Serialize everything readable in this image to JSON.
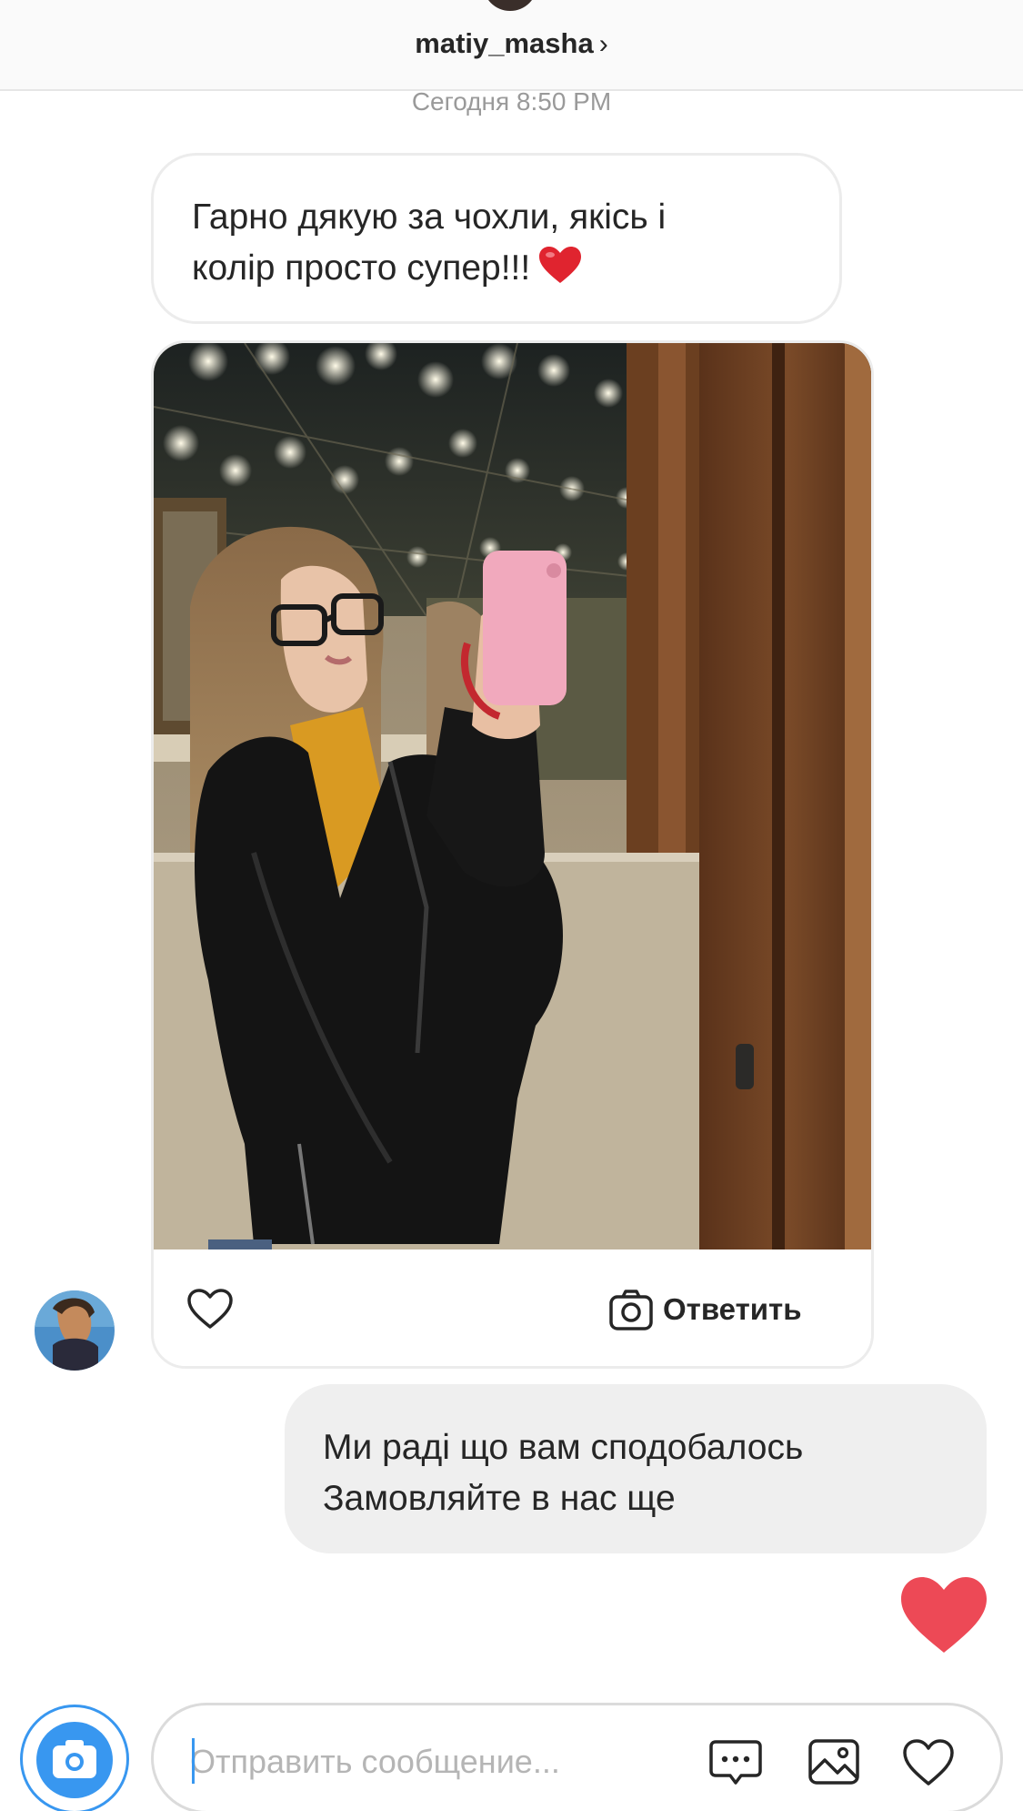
{
  "header": {
    "username": "matiy_masha",
    "chevron": "›"
  },
  "conversation": {
    "timestamp": "Сегодня 8:50 PM",
    "received_message": {
      "line1": "Гарно дякую за чохли, якісь і",
      "line2": "колір просто супер!!!",
      "emoji": "heart-emoji"
    },
    "shared_post": {
      "reply_label": "Ответить",
      "like_icon": "heart-outline-icon",
      "reply_icon": "camera-icon"
    },
    "sent_message": {
      "line1": "Ми раді що вам сподобалось",
      "line2": "Замовляйте в нас ще"
    },
    "sent_reaction": "red-heart-icon"
  },
  "composer": {
    "placeholder": "Отправить сообщение...",
    "value": "",
    "icons": [
      "camera-icon",
      "sticker-chat-icon",
      "gallery-icon",
      "heart-outline-icon"
    ]
  },
  "colors": {
    "accent_blue": "#3897f0",
    "heart_red": "#ed4956",
    "sent_bubble": "#efefef",
    "border": "#ececec"
  }
}
